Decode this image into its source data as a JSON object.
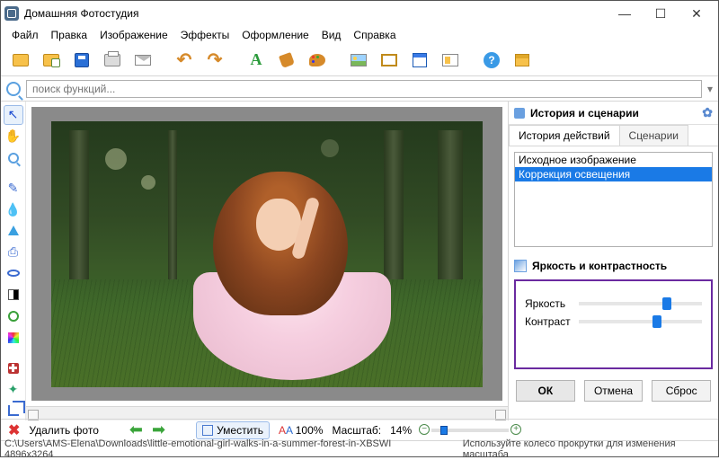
{
  "window": {
    "title": "Домашняя Фотостудия"
  },
  "menu": {
    "file": "Файл",
    "edit": "Правка",
    "image": "Изображение",
    "effects": "Эффекты",
    "design": "Оформление",
    "view": "Вид",
    "help": "Справка"
  },
  "search": {
    "placeholder": "поиск функций..."
  },
  "panel": {
    "title": "История и сценарии",
    "tabs": {
      "history": "История действий",
      "scenarios": "Сценарии"
    },
    "history_items": [
      "Исходное изображение",
      "Коррекция освещения"
    ],
    "bc_title": "Яркость и контрастность",
    "brightness_label": "Яркость",
    "contrast_label": "Контраст",
    "brightness_pct": 68,
    "contrast_pct": 60,
    "ok": "ОК",
    "cancel": "Отмена",
    "reset": "Сброс"
  },
  "bottom": {
    "delete": "Удалить фото",
    "fit": "Уместить",
    "hundred": "100%",
    "scale_label": "Масштаб:",
    "scale_value": "14%"
  },
  "status": {
    "path": "C:\\Users\\AMS-Elena\\Downloads\\little-emotional-girl-walks-in-a-summer-forest-in-XBSWI 4896x3264",
    "hint": "Используйте колесо прокрутки для изменения масштаба"
  }
}
